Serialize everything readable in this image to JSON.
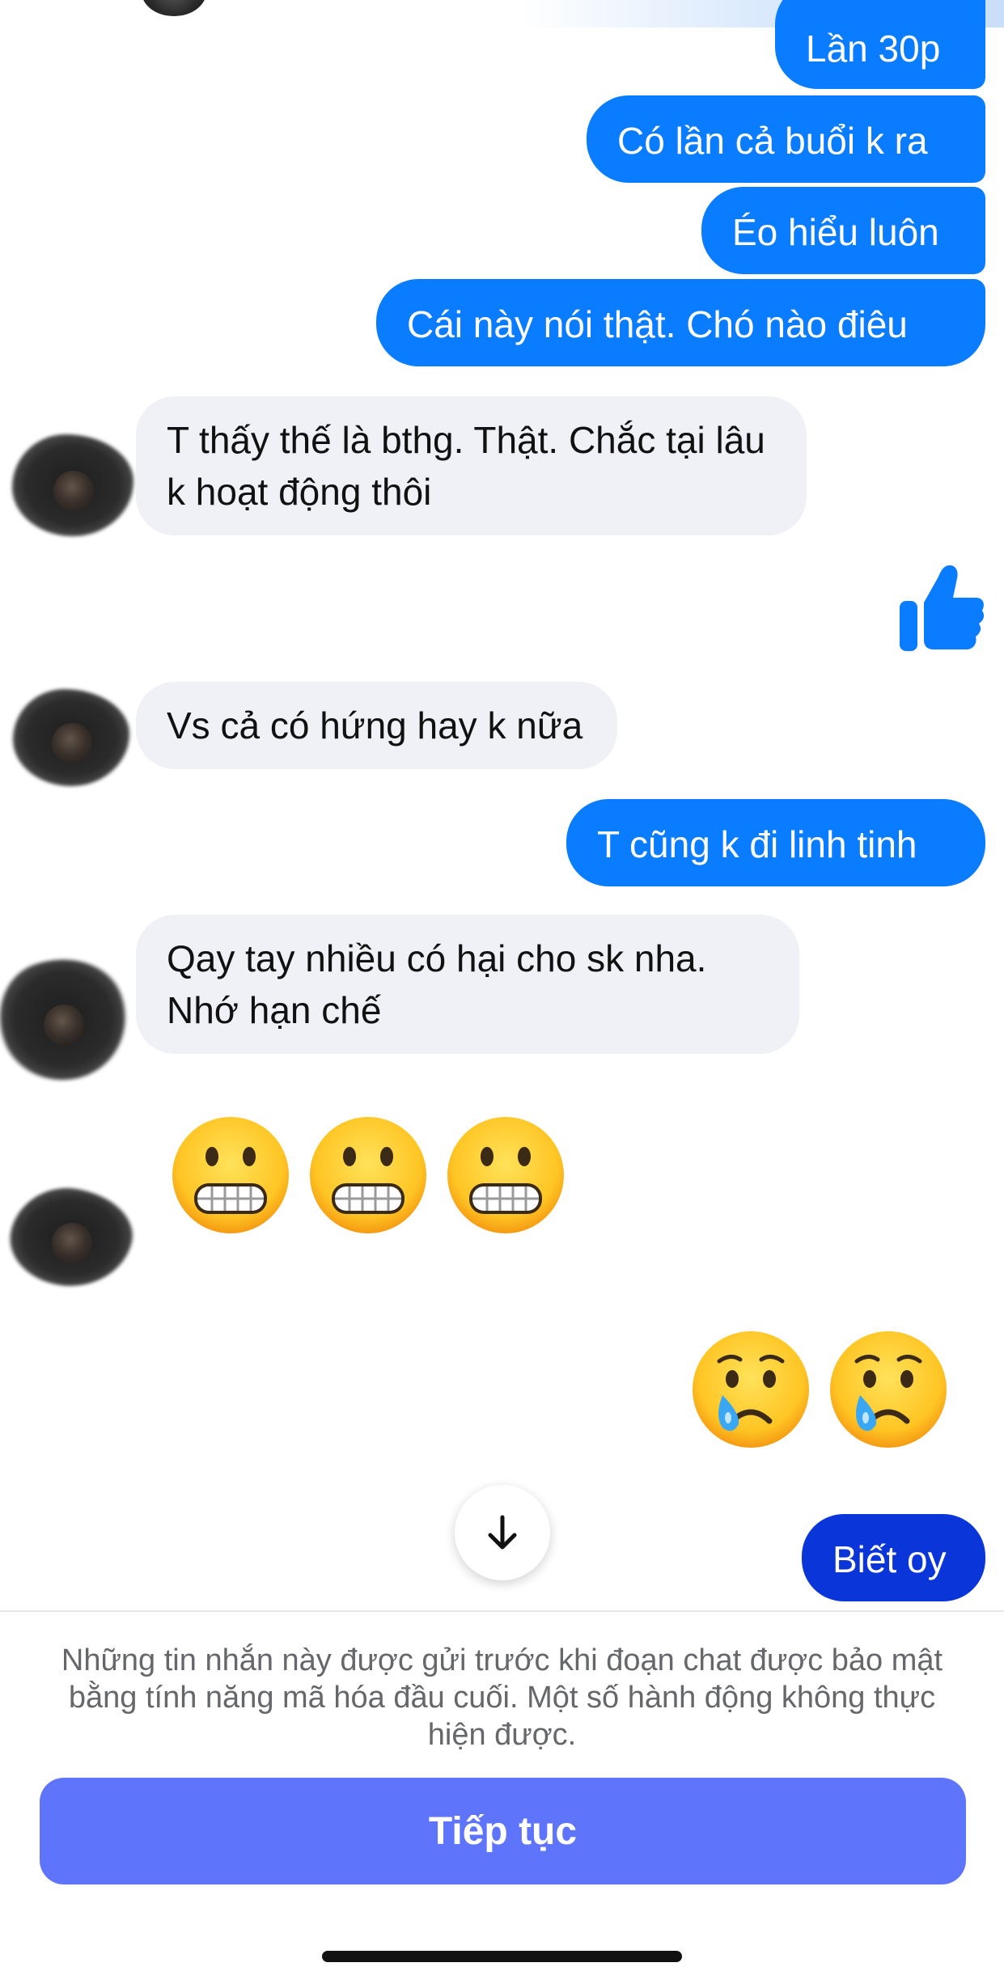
{
  "conversation": {
    "messages": [
      {
        "direction": "out",
        "text": "Lần 30p"
      },
      {
        "direction": "out",
        "text": "Có lần cả buổi k ra"
      },
      {
        "direction": "out",
        "text": "Éo hiểu luôn"
      },
      {
        "direction": "out",
        "text": "Cái này nói thật. Chó nào điêu"
      },
      {
        "direction": "in",
        "text": "T thấy thế là bthg. Thật. Chắc tại lâu k hoạt động thôi"
      },
      {
        "direction": "out",
        "type": "like",
        "icon": "thumbs-up-icon"
      },
      {
        "direction": "in",
        "text": "Vs cả có hứng hay k nữa"
      },
      {
        "direction": "out",
        "text": "T cũng k đi linh tinh"
      },
      {
        "direction": "in",
        "text": "Qay tay nhiều có hại cho sk nha. Nhớ hạn chế"
      },
      {
        "direction": "in",
        "type": "emoji",
        "emoji": [
          "grimacing-face",
          "grimacing-face",
          "grimacing-face"
        ]
      },
      {
        "direction": "out",
        "type": "emoji",
        "emoji": [
          "crying-face",
          "crying-face"
        ]
      },
      {
        "direction": "out",
        "text": "Biết oy"
      }
    ]
  },
  "scroll_button": {
    "icon": "arrow-down-icon"
  },
  "footer": {
    "notice": "Những tin nhắn này được gửi trước khi đoạn chat được bảo mật bằng tính năng mã hóa đầu cuối. Một số hành động không thực hiện được.",
    "continue_label": "Tiếp tục"
  },
  "colors": {
    "outgoing_bubble": "#0a7cff",
    "outgoing_bubble_last": "#0a35d9",
    "incoming_bubble": "#eff1f6",
    "continue_button": "#5e74fb",
    "notice_text": "#65676b"
  }
}
